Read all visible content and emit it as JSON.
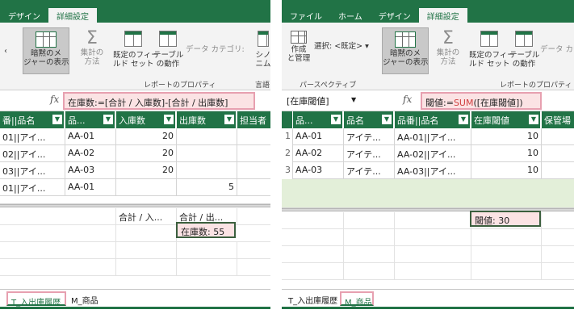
{
  "left": {
    "tabs": [
      {
        "label": "デザイン",
        "active": false
      },
      {
        "label": "詳細設定",
        "active": true
      }
    ],
    "ribbon": {
      "implicit_measures": "暗黙のメジャーの表示",
      "implicit_measures_l1": "暗黙のメ",
      "implicit_measures_l2": "ジャーの表示",
      "summarize_l1": "集計の",
      "summarize_l2": "方法",
      "default_field_set_l1": "既定のフィー",
      "default_field_set_l2": "ルド セット",
      "table_behavior_l1": "テーブル",
      "table_behavior_l2": "の動作",
      "data_category": "データ カテゴリ:",
      "synonyms_l1": "シノ",
      "synonyms_l2": "ニム",
      "language": "言語",
      "group_reporting": "レポートのプロパティ"
    },
    "formula_bar": {
      "fx": "fx",
      "formula": "在庫数:=[合計 / 入庫数]-[合計 / 出庫数]"
    },
    "table": {
      "headers": [
        "番||品名",
        "品...",
        "入庫数",
        "出庫数",
        "担当者"
      ],
      "rows": [
        [
          "01||アイ...",
          "AA-01",
          "20",
          ""
        ],
        [
          "02||アイ...",
          "AA-02",
          "20",
          ""
        ],
        [
          "03||アイ...",
          "AA-03",
          "20",
          ""
        ],
        [
          "01||アイ...",
          "AA-01",
          "",
          "5"
        ]
      ]
    },
    "calc_area": {
      "measure_header_1": "合計 / 入...",
      "measure_header_2": "合計 / 出...",
      "measure_value": "在庫数: 55"
    },
    "sheets": [
      {
        "label": "T_入出庫履歴",
        "active": true
      },
      {
        "label": "M_商品",
        "active": false
      }
    ]
  },
  "right": {
    "tabs": [
      {
        "label": "ファイル",
        "active": false
      },
      {
        "label": "ホーム",
        "active": false
      },
      {
        "label": "デザイン",
        "active": false
      },
      {
        "label": "詳細設定",
        "active": true
      }
    ],
    "ribbon": {
      "create_manage_l1": "作成",
      "create_manage_l2": "と管理",
      "select_label": "選択: <既定>",
      "group_perspectives": "パースペクティブ",
      "implicit_measures_l1": "暗黙のメ",
      "implicit_measures_l2": "ジャーの表示",
      "summarize_l1": "集計の",
      "summarize_l2": "方法",
      "default_field_set_l1": "既定のフィー",
      "default_field_set_l2": "ルド セット",
      "table_behavior_l1": "テーブル",
      "table_behavior_l2": "の動作",
      "data_category": "データ カテ",
      "group_reporting": "レポートのプロパティ"
    },
    "formula_bar": {
      "name_box": "[在庫閾値]",
      "fx": "fx",
      "formula_prefix": "閾値:=",
      "formula_func": "SUM",
      "formula_suffix": "([在庫閾値])"
    },
    "table": {
      "headers": [
        "品...",
        "品名",
        "品番||品名",
        "在庫閾値",
        "保管場"
      ],
      "rows": [
        [
          "1",
          "AA-01",
          "アイテ...",
          "AA-01||アイ...",
          "10"
        ],
        [
          "2",
          "AA-02",
          "アイテ...",
          "AA-02||アイ...",
          "10"
        ],
        [
          "3",
          "AA-03",
          "アイテ...",
          "AA-03||アイ...",
          "10"
        ]
      ]
    },
    "calc_area": {
      "measure_value": "閾値: 30"
    },
    "sheets": [
      {
        "label": "T_入出庫履歴",
        "active": false
      },
      {
        "label": "M_商品",
        "active": true
      }
    ]
  },
  "colors": {
    "accent": "#217346",
    "highlight": "#fbe3e4",
    "callout_border": "#e7a0b0"
  }
}
